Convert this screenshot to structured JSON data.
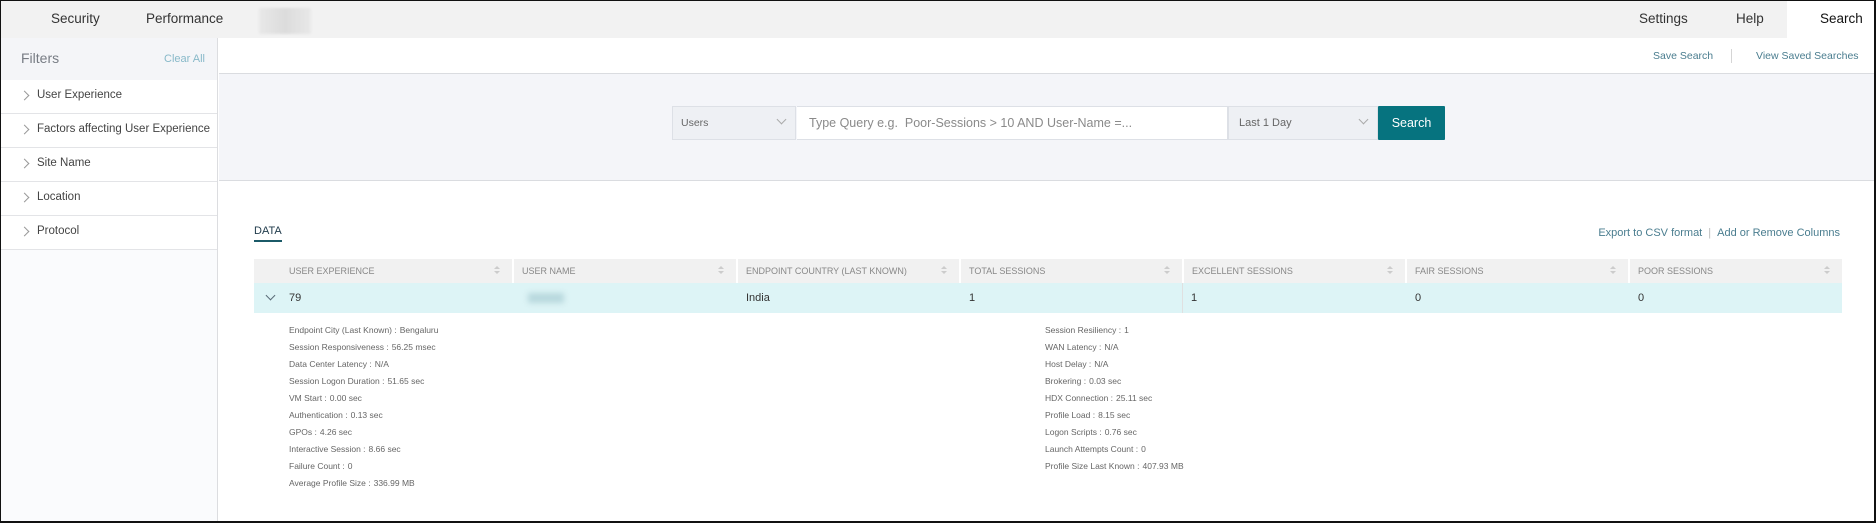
{
  "topnav": {
    "left_tabs": [
      "Security",
      "Performance"
    ],
    "right_tabs": [
      "Settings",
      "Help",
      "Search"
    ],
    "active_tab": "Search"
  },
  "sidebar": {
    "title": "Filters",
    "clear_all": "Clear All",
    "items": [
      {
        "label": "User Experience"
      },
      {
        "label": "Factors affecting User Experience"
      },
      {
        "label": "Site Name"
      },
      {
        "label": "Location"
      },
      {
        "label": "Protocol"
      }
    ]
  },
  "subbar": {
    "save_search": "Save Search",
    "view_saved": "View Saved Searches"
  },
  "search": {
    "entity": "Users",
    "query_placeholder": "Type Query e.g.  Poor-Sessions > 10 AND User-Name =...",
    "query_value": "",
    "range": "Last 1 Day",
    "button": "Search",
    "accent_color": "#06737f"
  },
  "data": {
    "tab": "DATA",
    "export": "Export to CSV format",
    "columns_link": "Add or Remove Columns",
    "columns": [
      "USER EXPERIENCE",
      "USER NAME",
      "ENDPOINT COUNTRY (LAST KNOWN)",
      "TOTAL SESSIONS",
      "EXCELLENT SESSIONS",
      "FAIR SESSIONS",
      "POOR SESSIONS"
    ],
    "rows": [
      {
        "user_experience": "79",
        "user_name": "",
        "endpoint_country": "India",
        "total_sessions": "1",
        "excellent_sessions": "1",
        "fair_sessions": "0",
        "poor_sessions": "0"
      }
    ],
    "details_left": [
      {
        "k": "Endpoint City (Last Known) :",
        "v": "Bengaluru"
      },
      {
        "k": "Session Responsiveness :",
        "v": "56.25 msec"
      },
      {
        "k": "Data Center Latency :",
        "v": "N/A"
      },
      {
        "k": "Session Logon Duration :",
        "v": "51.65 sec"
      },
      {
        "k": "VM Start :",
        "v": "0.00 sec"
      },
      {
        "k": "Authentication :",
        "v": "0.13 sec"
      },
      {
        "k": "GPOs :",
        "v": "4.26 sec"
      },
      {
        "k": "Interactive Session :",
        "v": "8.66 sec"
      },
      {
        "k": "Failure Count :",
        "v": "0"
      },
      {
        "k": "Average Profile Size :",
        "v": "336.99 MB"
      }
    ],
    "details_right": [
      {
        "k": "Session Resiliency :",
        "v": "1"
      },
      {
        "k": "WAN Latency :",
        "v": "N/A"
      },
      {
        "k": "Host Delay :",
        "v": "N/A"
      },
      {
        "k": "Brokering :",
        "v": "0.03 sec"
      },
      {
        "k": "HDX Connection :",
        "v": "25.11 sec"
      },
      {
        "k": "Profile Load :",
        "v": "8.15 sec"
      },
      {
        "k": "Logon Scripts :",
        "v": "0.76 sec"
      },
      {
        "k": "Launch Attempts Count :",
        "v": "0"
      },
      {
        "k": "Profile Size Last Known :",
        "v": "407.93 MB"
      }
    ]
  }
}
